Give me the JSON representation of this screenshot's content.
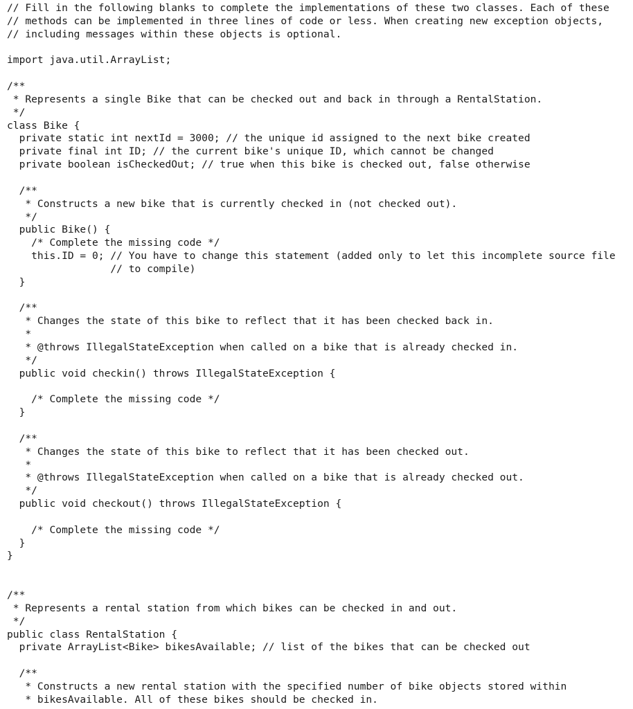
{
  "document": {
    "kind": "source-code-listing",
    "language": "Java",
    "background_color": "#ffffff",
    "text_color": "#1a1a1a",
    "font_style": "monospace",
    "lines": [
      "// Fill in the following blanks to complete the implementations of these two classes. Each of these",
      "// methods can be implemented in three lines of code or less. When creating new exception objects,",
      "// including messages within these objects is optional.",
      "",
      "import java.util.ArrayList;",
      "",
      "/**",
      " * Represents a single Bike that can be checked out and back in through a RentalStation.",
      " */",
      "class Bike {",
      "  private static int nextId = 3000; // the unique id assigned to the next bike created",
      "  private final int ID; // the current bike's unique ID, which cannot be changed",
      "  private boolean isCheckedOut; // true when this bike is checked out, false otherwise",
      "",
      "  /**",
      "   * Constructs a new bike that is currently checked in (not checked out).",
      "   */",
      "  public Bike() {",
      "    /* Complete the missing code */",
      "    this.ID = 0; // You have to change this statement (added only to let this incomplete source file",
      "                 // to compile)",
      "  }",
      "",
      "  /**",
      "   * Changes the state of this bike to reflect that it has been checked back in.",
      "   *",
      "   * @throws IllegalStateException when called on a bike that is already checked in.",
      "   */",
      "  public void checkin() throws IllegalStateException {",
      "",
      "    /* Complete the missing code */",
      "  }",
      "",
      "  /**",
      "   * Changes the state of this bike to reflect that it has been checked out.",
      "   *",
      "   * @throws IllegalStateException when called on a bike that is already checked out.",
      "   */",
      "  public void checkout() throws IllegalStateException {",
      "",
      "    /* Complete the missing code */",
      "  }",
      "}",
      "",
      "",
      "/**",
      " * Represents a rental station from which bikes can be checked in and out.",
      " */",
      "public class RentalStation {",
      "  private ArrayList<Bike> bikesAvailable; // list of the bikes that can be checked out",
      "",
      "  /**",
      "   * Constructs a new rental station with the specified number of bike objects stored within",
      "   * bikesAvailable. All of these bikes should be checked in."
    ]
  }
}
